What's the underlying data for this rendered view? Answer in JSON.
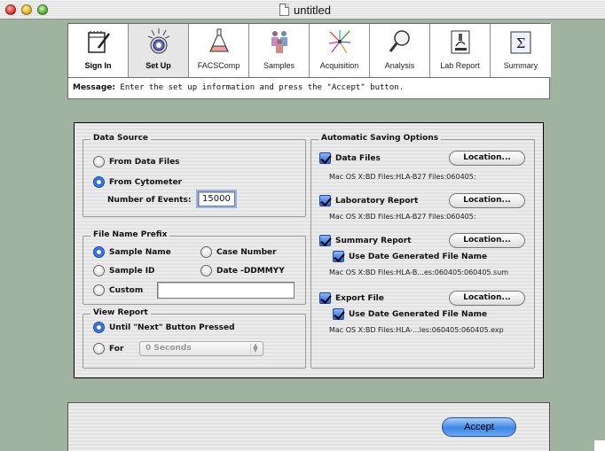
{
  "window": {
    "title": "untitled"
  },
  "toolbar": {
    "tools": [
      {
        "label": "Sign In",
        "icon": "notebook-pencil-icon"
      },
      {
        "label": "Set Up",
        "icon": "setup-target-icon"
      },
      {
        "label": "FACSComp",
        "icon": "flask-icon"
      },
      {
        "label": "Samples",
        "icon": "people-icon"
      },
      {
        "label": "Acquisition",
        "icon": "burst-icon"
      },
      {
        "label": "Analysis",
        "icon": "magnifier-icon"
      },
      {
        "label": "Lab Report",
        "icon": "microscope-icon"
      },
      {
        "label": "Summary",
        "icon": "sigma-icon"
      }
    ],
    "active_index": 1
  },
  "message": {
    "prefix": "Message:",
    "text": "Enter the set up information and press the \"Accept\" button."
  },
  "data_source": {
    "title": "Data Source",
    "from_data_files": "From Data Files",
    "from_cytometer": "From Cytometer",
    "events_label": "Number of Events:",
    "events_value": "15000",
    "selected": "from_cytometer"
  },
  "file_name_prefix": {
    "title": "File Name Prefix",
    "sample_name": "Sample Name",
    "case_number": "Case Number",
    "sample_id": "Sample ID",
    "date": "Date -DDMMYY",
    "custom": "Custom",
    "custom_value": "",
    "selected": "sample_name"
  },
  "view_report": {
    "title": "View Report",
    "until_next": "Until \"Next\" Button Pressed",
    "for_label": "For",
    "for_value": "0 Seconds",
    "selected": "until_next"
  },
  "auto_save": {
    "title": "Automatic Saving Options",
    "location_label": "Location...",
    "use_date_label": "Use Date Generated File Name",
    "data_files": {
      "label": "Data Files",
      "path": "Mac OS X:BD Files:HLA-B27 Files:060405:",
      "checked": true
    },
    "lab_report": {
      "label": "Laboratory Report",
      "path": "Mac OS X:BD Files:HLA-B27 Files:060405:",
      "checked": true
    },
    "summary_report": {
      "label": "Summary Report",
      "path": "Mac OS X:BD Files:HLA-B...es:060405:060405.sum",
      "checked": true,
      "use_date": true
    },
    "export_file": {
      "label": "Export File",
      "path": "Mac OS X:BD Files:HLA-...les:060405:060405.exp",
      "checked": true,
      "use_date": true
    }
  },
  "accept_label": "Accept",
  "colors": {
    "background": "#9fb3a0",
    "accent": "#3d86e6",
    "panel": "#e8e8e8"
  }
}
